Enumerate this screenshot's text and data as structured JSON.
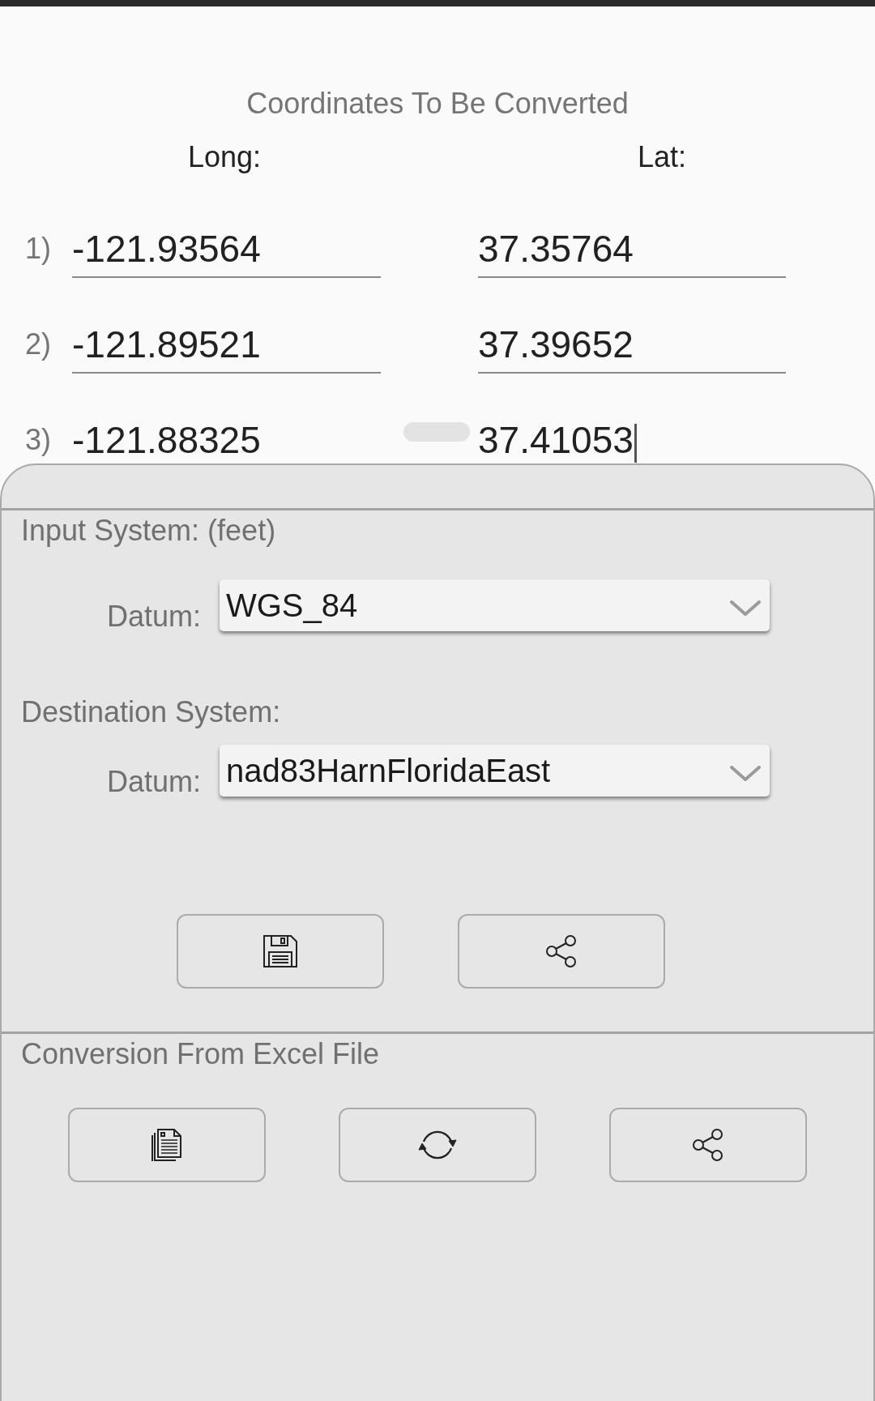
{
  "coordinates": {
    "title": "Coordinates To Be Converted",
    "columns": [
      "Long:",
      "Lat:"
    ],
    "rows": [
      {
        "label": "1)",
        "long": {
          "value": "-121.93564",
          "focused": false
        },
        "lat": {
          "value": "37.35764",
          "focused": false
        }
      },
      {
        "label": "2)",
        "long": {
          "value": "-121.89521",
          "focused": false
        },
        "lat": {
          "value": "37.39652",
          "focused": false
        }
      },
      {
        "label": "3)",
        "long": {
          "value": "-121.88325",
          "focused": false
        },
        "lat": {
          "value": "37.41053",
          "focused": true
        }
      }
    ]
  },
  "input_system": {
    "heading": "Input System: (feet)",
    "datum_label": "Datum:",
    "datum": "WGS_84"
  },
  "destination_system": {
    "heading": "Destination System:",
    "datum_label": "Datum:",
    "datum": "nad83HarnFloridaEast"
  },
  "excel_conversion": {
    "heading": "Conversion From Excel File"
  }
}
